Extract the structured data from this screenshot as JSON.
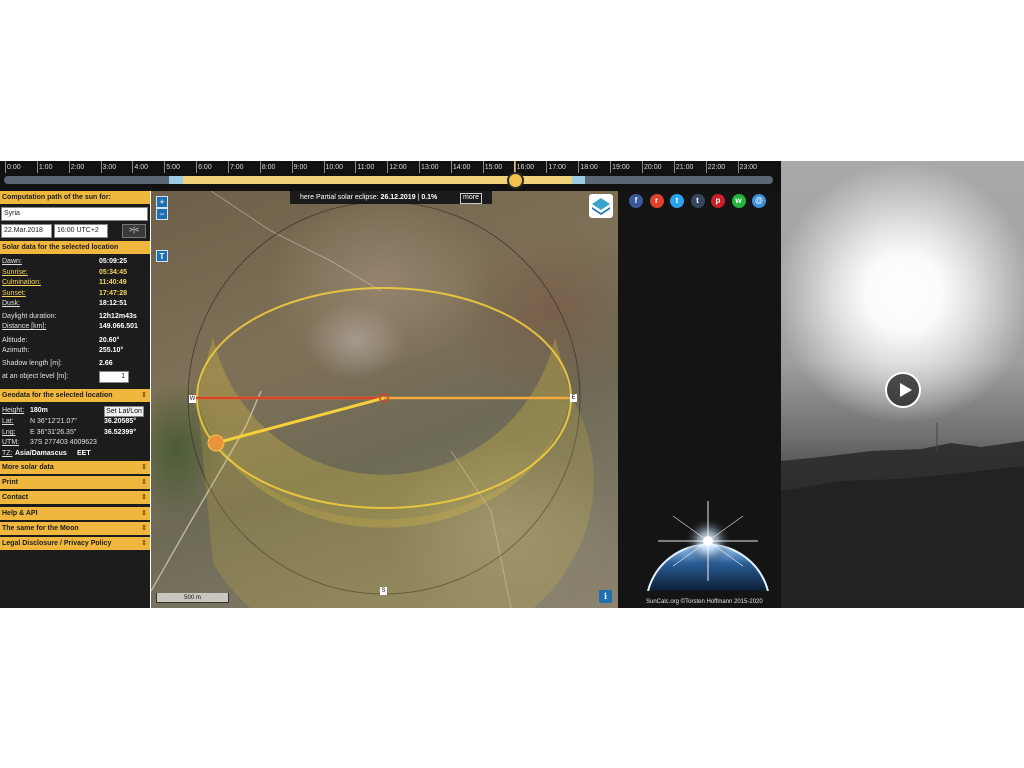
{
  "timeline": {
    "hours": [
      "0:00",
      "1:00",
      "2:00",
      "3:00",
      "4:00",
      "5:00",
      "6:00",
      "7:00",
      "8:00",
      "9:00",
      "10:00",
      "11:00",
      "12:00",
      "13:00",
      "14:00",
      "15:00",
      "16:00",
      "17:00",
      "18:00",
      "19:00",
      "20:00",
      "21:00",
      "22:00",
      "23:00"
    ],
    "current_hour_fraction": 16.0,
    "sunrise_hour_fraction": 5.58,
    "sunset_hour_fraction": 17.79,
    "dawn_hour_fraction": 5.15,
    "dusk_hour_fraction": 18.21,
    "colors": {
      "day": "#f0d27a",
      "twilight": "#9ec9e6",
      "night": "#5c6775",
      "handle": "#f2c14e"
    }
  },
  "sidebar": {
    "computation_header": "Computation path of the sun for:",
    "location_value": "Syria",
    "date_value": "22.Mar.2018",
    "time_value": "16:00 UTC+2",
    "now_button": ">|<",
    "solar_header": "Solar data for the selected location",
    "solar_rows": [
      {
        "label": "Dawn:",
        "value": "05:09:25"
      },
      {
        "label": "Sunrise:",
        "value": "05:34:45"
      },
      {
        "label": "Culmination:",
        "value": "11:40:49"
      },
      {
        "label": "Sunset:",
        "value": "17:47:28"
      },
      {
        "label": "Dusk:",
        "value": "18:12:51"
      },
      {
        "label": "Daylight duration:",
        "value": "12h12m43s"
      },
      {
        "label": "Distance [km]:",
        "value": "149.066.501"
      },
      {
        "label": "Altitude:",
        "value": "20.60°"
      },
      {
        "label": "Azimuth:",
        "value": "255.10°"
      },
      {
        "label": "Shadow length [m]:",
        "value": "2.66"
      },
      {
        "label": "at an object level [m]:",
        "value": "1"
      }
    ],
    "geo_header": "Geodata for the selected location",
    "height_label": "Height:",
    "height_value": "180m",
    "set_latlon_button": "Set Lat/Lon",
    "lat_label": "Lat:",
    "lat_dms": "N 36°12'21.07\"",
    "lat_dec": "36.20585°",
    "lng_label": "Lng:",
    "lng_dms": "E 36°31'26.35\"",
    "lng_dec": "36.52399°",
    "utm_label": "UTM:",
    "utm_value": "37S 277403 4009623",
    "tz_label": "TZ:",
    "tz_value": "Asia/Damascus",
    "tz_abbr": "EET",
    "menu": [
      "More solar data",
      "Print",
      "Contact",
      "Help & API",
      "The same for the Moon",
      "Legal Disclosure / Privacy Policy"
    ]
  },
  "map": {
    "eclipse_prefix": "here Partial solar eclipse:",
    "eclipse_date": "26.12.2019",
    "eclipse_percent": "0.1%",
    "more_button": "more",
    "zoom_in": "+",
    "zoom_out": "−",
    "t_button": "T",
    "scale": "500 m",
    "info_button": "i",
    "compass": {
      "n": "N",
      "s": "S",
      "w": "W",
      "e": "E"
    },
    "colors": {
      "sun_path": "#f5d03b",
      "sunrise_line": "#f3a93b",
      "sunset_line": "#d9442b",
      "current_sun": "#e8953a"
    }
  },
  "share": {
    "icons": [
      {
        "name": "facebook-icon",
        "glyph": "f",
        "color": "#3b5998"
      },
      {
        "name": "reddit-icon",
        "glyph": "r",
        "color": "#e0412f"
      },
      {
        "name": "twitter-icon",
        "glyph": "t",
        "color": "#2aa3ef"
      },
      {
        "name": "tumblr-icon",
        "glyph": "t",
        "color": "#35465c"
      },
      {
        "name": "pinterest-icon",
        "glyph": "p",
        "color": "#cb2027"
      },
      {
        "name": "whatsapp-icon",
        "glyph": "w",
        "color": "#25b43c"
      },
      {
        "name": "email-icon",
        "glyph": "@",
        "color": "#3b8fd9"
      }
    ],
    "credit": "SunCalc.org ©Torsten Hoffmann 2015-2020"
  },
  "video": {
    "play_icon": "play-icon"
  }
}
